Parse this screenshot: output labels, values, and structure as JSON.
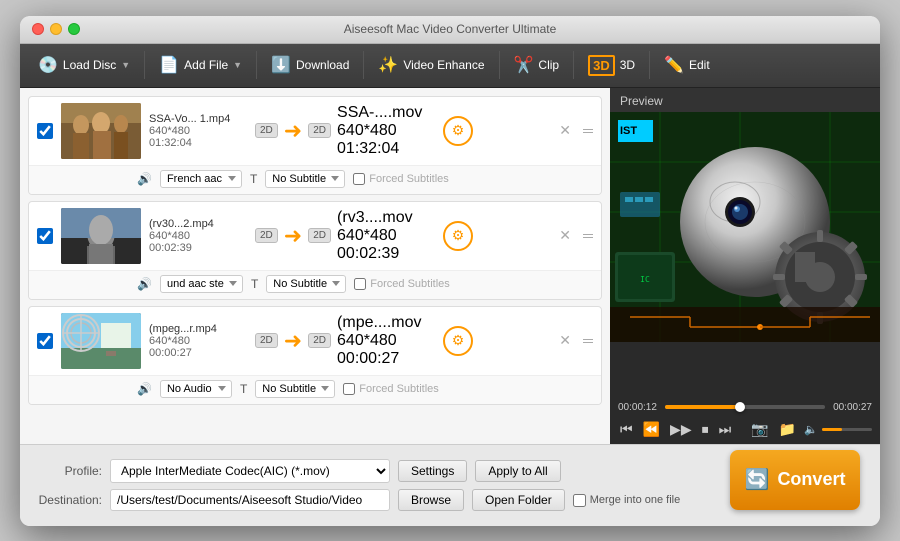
{
  "window": {
    "title": "Aiseesoft Mac Video Converter Ultimate"
  },
  "toolbar": {
    "load_disc": "Load Disc",
    "add_file": "Add File",
    "download": "Download",
    "video_enhance": "Video Enhance",
    "clip": "Clip",
    "three_d": "3D",
    "edit": "Edit"
  },
  "files": [
    {
      "id": 1,
      "checked": true,
      "input_name": "SSA-Vo... 1.mp4",
      "input_res": "640*480",
      "input_dur": "01:32:04",
      "output_name": "SSA-....mov",
      "output_res": "640*480",
      "output_dur": "01:32:04",
      "audio": "French aac",
      "subtitle": "No Subtitle",
      "has_forced": false
    },
    {
      "id": 2,
      "checked": true,
      "input_name": "(rv30...2.mp4",
      "input_res": "640*480",
      "input_dur": "00:02:39",
      "output_name": "(rv3....mov",
      "output_res": "640*480",
      "output_dur": "00:02:39",
      "audio": "und aac ste",
      "subtitle": "No Subtitle",
      "has_forced": false
    },
    {
      "id": 3,
      "checked": true,
      "input_name": "(mpeg...r.mp4",
      "input_res": "640*480",
      "input_dur": "00:00:27",
      "output_name": "(mpe....mov",
      "output_res": "640*480",
      "output_dur": "00:00:27",
      "audio": "No Audio",
      "subtitle": "No Subtitle",
      "has_forced": false
    }
  ],
  "preview": {
    "label": "Preview",
    "time_current": "00:00:12",
    "time_total": "00:00:27"
  },
  "bottom": {
    "profile_label": "Profile:",
    "profile_value": "Apple InterMediate Codec(AIC) (*.mov)",
    "settings_btn": "Settings",
    "apply_all_btn": "Apply to All",
    "dest_label": "Destination:",
    "dest_value": "/Users/test/Documents/Aiseesoft Studio/Video",
    "browse_btn": "Browse",
    "open_folder_btn": "Open Folder",
    "merge_label": "Merge into one file",
    "convert_btn": "Convert"
  }
}
